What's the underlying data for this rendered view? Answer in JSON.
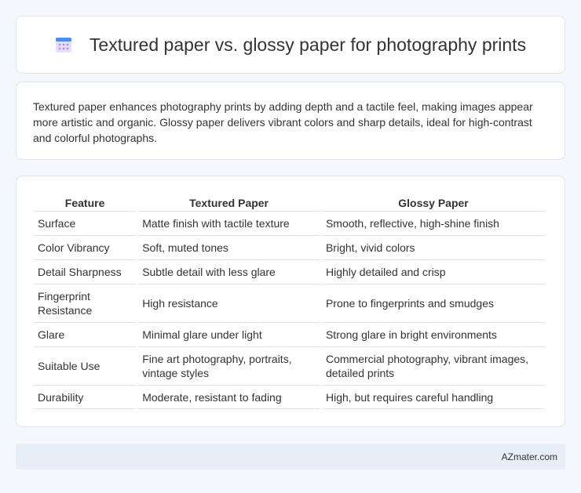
{
  "header": {
    "title": "Textured paper vs. glossy paper for photography prints",
    "icon": "calendar-grid-icon",
    "icon_colors": {
      "top": "#4a8ef0",
      "body": "#e9defa",
      "dots": "#b390e8"
    }
  },
  "intro": {
    "text": "Textured paper enhances photography prints by adding depth and a tactile feel, making images appear more artistic and organic. Glossy paper delivers vibrant colors and sharp details, ideal for high-contrast and colorful photographs."
  },
  "table": {
    "headers": [
      "Feature",
      "Textured Paper",
      "Glossy Paper"
    ],
    "rows": [
      [
        "Surface",
        "Matte finish with tactile texture",
        "Smooth, reflective, high-shine finish"
      ],
      [
        "Color Vibrancy",
        "Soft, muted tones",
        "Bright, vivid colors"
      ],
      [
        "Detail Sharpness",
        "Subtle detail with less glare",
        "Highly detailed and crisp"
      ],
      [
        "Fingerprint Resistance",
        "High resistance",
        "Prone to fingerprints and smudges"
      ],
      [
        "Glare",
        "Minimal glare under light",
        "Strong glare in bright environments"
      ],
      [
        "Suitable Use",
        "Fine art photography, portraits, vintage styles",
        "Commercial photography, vibrant images, detailed prints"
      ],
      [
        "Durability",
        "Moderate, resistant to fading",
        "High, but requires careful handling"
      ]
    ]
  },
  "footer": {
    "text": "AZmater.com"
  }
}
